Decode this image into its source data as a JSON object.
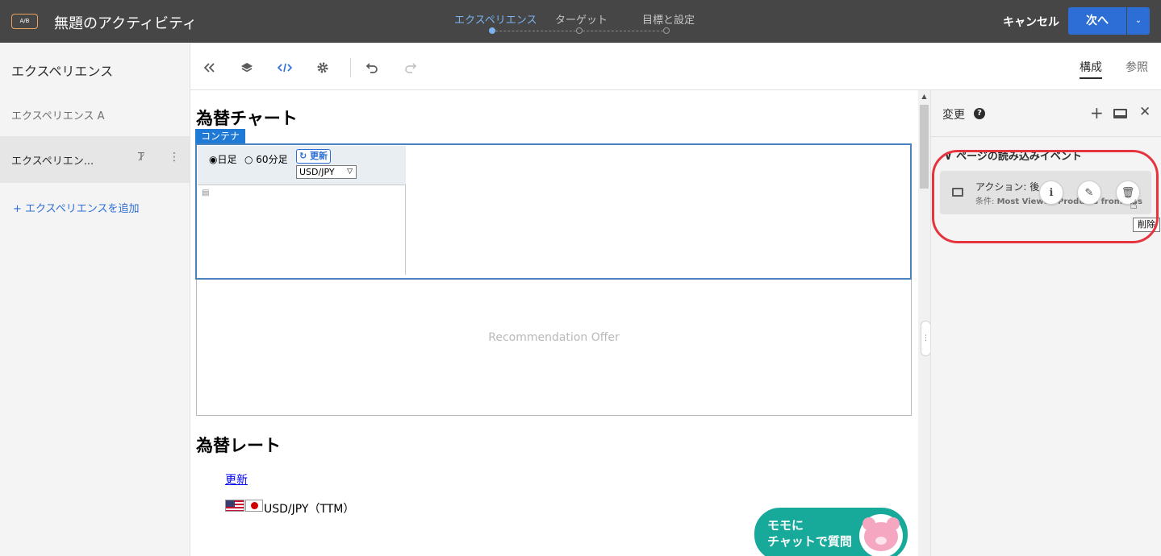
{
  "topbar": {
    "badge": "A/B",
    "title": "無題のアクティビティ",
    "steps": [
      {
        "label": "エクスペリエンス",
        "active": true
      },
      {
        "label": "ターゲット",
        "active": false
      },
      {
        "label": "目標と設定",
        "active": false
      }
    ],
    "cancel_label": "キャンセル",
    "next_label": "次へ",
    "next_menu_icon": "chevron-down-icon",
    "accent_color": "#2c6ed5"
  },
  "left_panel": {
    "header": "エクスペリエンス",
    "experiences": [
      {
        "label": "エクスペリエンス A",
        "selected": false
      },
      {
        "label": "エクスペリエン...",
        "selected": true
      }
    ],
    "add_label": "+ エクスペリエンスを追加"
  },
  "toolbar": {
    "icons": [
      "collapse-left-icon",
      "layers-icon",
      "code-icon",
      "gear-icon",
      "undo-icon",
      "redo-icon"
    ],
    "tab_compose": "構成",
    "tab_browse": "参照"
  },
  "canvas": {
    "chart_heading": "為替チャート",
    "container_tag": "コンテナ",
    "radio_day": "日足",
    "radio_60": "60分足",
    "refresh_label": "更新",
    "currency_value": "USD/JPY",
    "recommendation_label": "Recommendation Offer",
    "rate_heading": "為替レート",
    "update_link": "更新",
    "rate_label": "USD/JPY（TTM）",
    "chat_text": "モモに\nチャットで質問"
  },
  "right_panel": {
    "title": "変更",
    "event_label": "ページの読み込みイベント",
    "card_action": "アクション: 後",
    "card_condition_prefix": "条件:",
    "card_condition_value": "Most Viewed Products from this",
    "tooltip": "削除",
    "highlight_color": "#e6343f"
  }
}
